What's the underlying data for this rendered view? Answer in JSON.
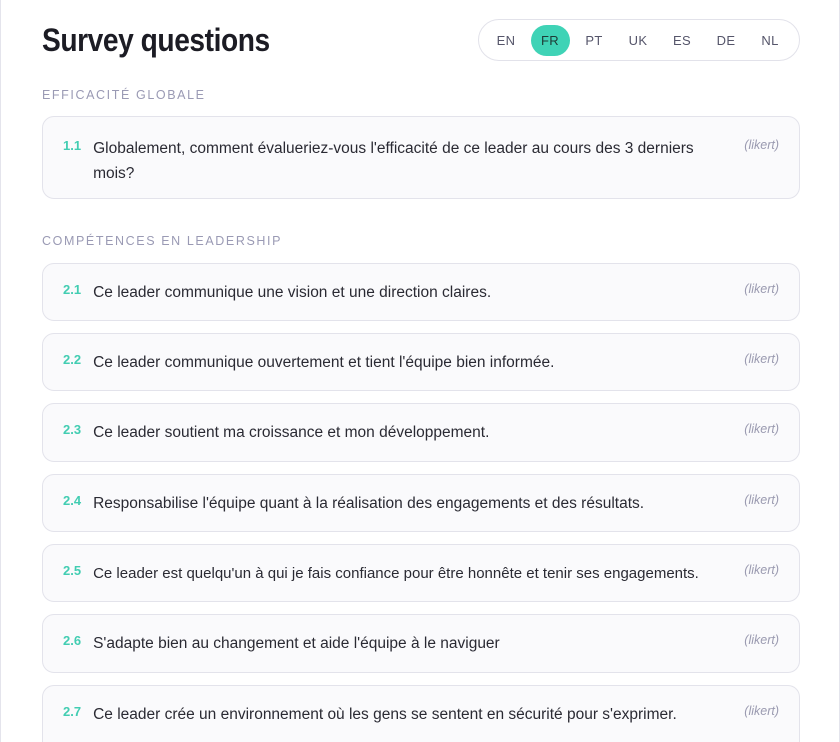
{
  "page": {
    "title": "Survey questions"
  },
  "languages": [
    {
      "code": "EN",
      "active": false
    },
    {
      "code": "FR",
      "active": true
    },
    {
      "code": "PT",
      "active": false
    },
    {
      "code": "UK",
      "active": false
    },
    {
      "code": "ES",
      "active": false
    },
    {
      "code": "DE",
      "active": false
    },
    {
      "code": "NL",
      "active": false
    }
  ],
  "sections": [
    {
      "label": "EFFICACITÉ GLOBALE",
      "questions": [
        {
          "num": "1.1",
          "text": "Globalement, comment évalueriez-vous l'efficacité de ce leader au cours des 3 derniers mois?",
          "type": "(likert)"
        }
      ]
    },
    {
      "label": "COMPÉTENCES EN LEADERSHIP",
      "questions": [
        {
          "num": "2.1",
          "text": "Ce leader communique une vision et une direction claires.",
          "type": "(likert)"
        },
        {
          "num": "2.2",
          "text": "Ce leader communique ouvertement et tient l'équipe bien informée.",
          "type": "(likert)"
        },
        {
          "num": "2.3",
          "text": "Ce leader soutient ma croissance et mon développement.",
          "type": "(likert)"
        },
        {
          "num": "2.4",
          "text": "Responsabilise l'équipe quant à la réalisation des engagements et des résultats.",
          "type": "(likert)"
        },
        {
          "num": "2.5",
          "text": "Ce leader est quelqu'un à qui je fais confiance pour être honnête et tenir ses engagements.",
          "type": "(likert)"
        },
        {
          "num": "2.6",
          "text": "S'adapte bien au changement et aide l'équipe à le naviguer",
          "type": "(likert)"
        },
        {
          "num": "2.7",
          "text": "Ce leader crée un environnement où les gens se sentent en sécurité pour s'exprimer.",
          "type": "(likert)"
        }
      ]
    }
  ]
}
